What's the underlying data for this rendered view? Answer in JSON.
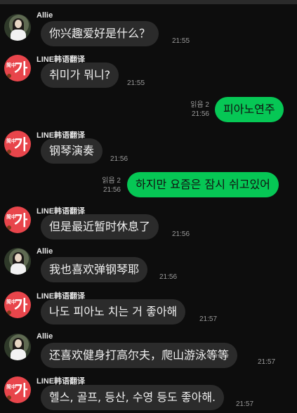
{
  "senders": {
    "allie": "Allie",
    "translator": "LINE韩语翻译",
    "translator_badge": "简中"
  },
  "translator_glyph": "가",
  "read_label": "읽음 2",
  "messages": [
    {
      "text": "你兴趣爱好是什么？",
      "time": "21:55"
    },
    {
      "text": "취미가 뭐니?",
      "time": "21:55"
    },
    {
      "text": "피아노연주",
      "time": "21:56"
    },
    {
      "text": "钢琴演奏",
      "time": "21:56"
    },
    {
      "text": "하지만 요즘은 잠시 쉬고있어",
      "time": "21:56"
    },
    {
      "text": "但是最近暂时休息了",
      "time": "21:56"
    },
    {
      "text": "我也喜欢弹钢琴耶",
      "time": "21:56"
    },
    {
      "text": "나도 피아노 치는 거 좋아해",
      "time": "21:57"
    },
    {
      "text": "还喜欢健身打高尔夫，爬山游泳等等",
      "time": "21:57"
    },
    {
      "text": "헬스, 골프, 등산, 수영 등도 좋아해.",
      "time": "21:57"
    }
  ],
  "colors": {
    "background": "#0d0d0d",
    "incoming_bubble": "#2b2b2b",
    "outgoing_bubble": "#06c755",
    "translator_avatar": "#e8454b"
  }
}
